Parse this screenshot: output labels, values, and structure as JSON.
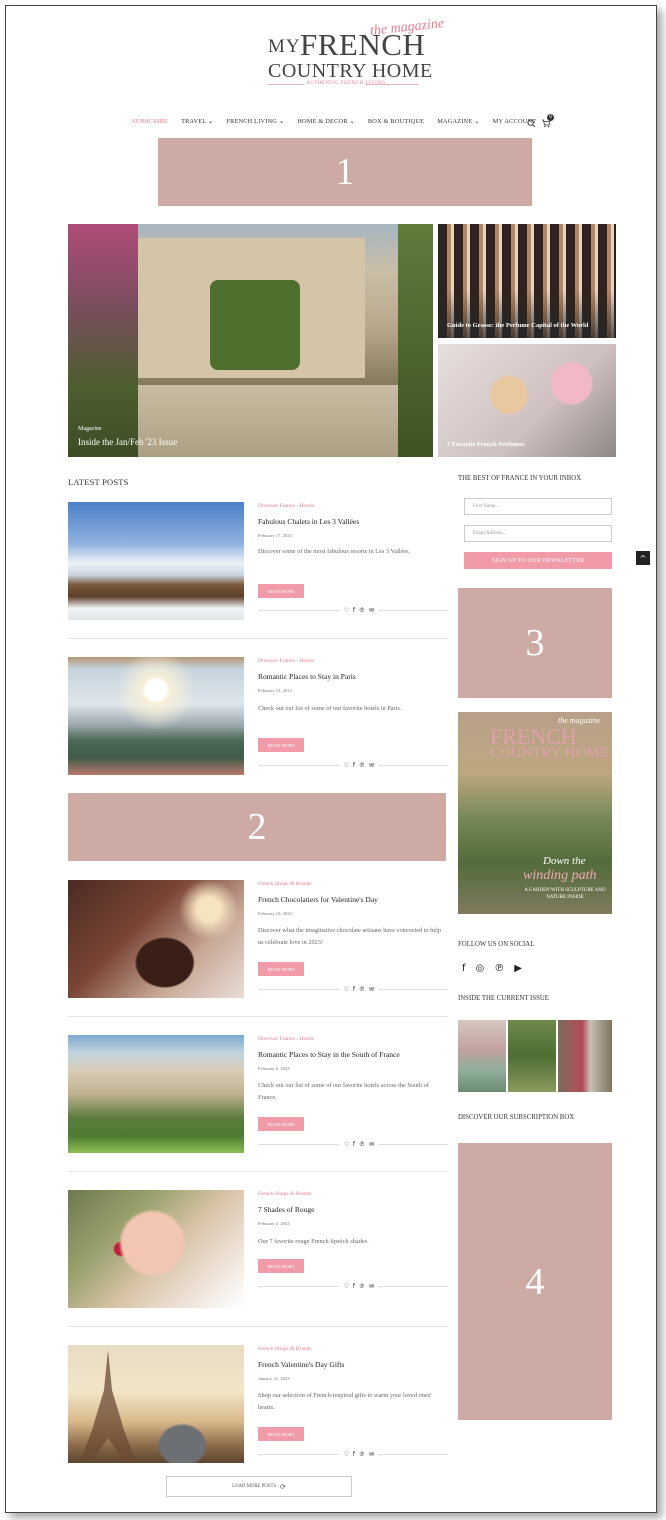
{
  "logo": {
    "my": "MY",
    "french": "FRENCH",
    "magazine": "the magazine",
    "country_home": "COUNTRY HOME",
    "tagline": "AUTHENTIC FRENCH LIVING"
  },
  "nav": {
    "items": [
      "SUBSCRIBE",
      "TRAVEL ⌄",
      "FRENCH LIVING ⌄",
      "HOME & DECOR ⌄",
      "BOX & BOUTIQUE",
      "MAGAZINE ⌄",
      "MY ACCOUNT"
    ],
    "cart_count": "0"
  },
  "ads": [
    "1",
    "2",
    "3",
    "4"
  ],
  "featured": {
    "main_category": "Magazine",
    "main_title": "Inside the Jan/Feb '23 Issue",
    "side": [
      {
        "title": "Guide to Grasse: the Perfume Capital of the World"
      },
      {
        "title": "7 Favorite French Perfumes"
      }
    ]
  },
  "latest_posts_title": "LATEST POSTS",
  "posts": [
    {
      "category": "Discover France  ›  Hotels",
      "title": "Fabulous Chalets in Les 3 Vallées",
      "date": "February 17, 2023",
      "excerpt": "Discover some of the most fabulous resorts in Les 3 Vallées.",
      "read_more": "READ MORE"
    },
    {
      "category": "Discover France  ›  Hotels",
      "title": "Romantic Places to Stay in Paris",
      "date": "February 13, 2023",
      "excerpt": "Check out our list of some of our favorite hotels in Paris.",
      "read_more": "READ MORE"
    },
    {
      "category": "French Shops & Brands",
      "title": "French Chocolatiers for Valentine's Day",
      "date": "February 10, 2023",
      "excerpt": "Discover what the imaginative chocolate artisans have concocted to help us celebrate love in 2023!",
      "read_more": "READ MORE"
    },
    {
      "category": "Discover France  ›  Hotels",
      "title": "Romantic Places to Stay in the South of France",
      "date": "February 6, 2023",
      "excerpt": "Check out our list of some of our favorite hotels across the South of France.",
      "read_more": "READ MORE"
    },
    {
      "category": "French Shops & Brands",
      "title": "7 Shades of Rouge",
      "date": "February 2, 2023",
      "excerpt": "Our 7 favorite rouge French lipstick shades.",
      "read_more": "READ MORE"
    },
    {
      "category": "French Shops & Brands",
      "title": "French Valentine's Day Gifts",
      "date": "January 31, 2023",
      "excerpt": "Shop our selection of French-inspired gifts to warm your loved ones' hearts.",
      "read_more": "READ MORE"
    }
  ],
  "share_icons": [
    "♡",
    "f",
    "℗",
    "✉"
  ],
  "load_more": "LOAD MORE POSTS",
  "sidebar": {
    "newsletter_title": "THE BEST OF FRANCE IN YOUR INBOX",
    "first_name_placeholder": "First Name...",
    "email_placeholder": "Email Address...",
    "signup_label": "SIGN UP TO OUR NEWSLETTER",
    "cover": {
      "magazine": "the magazine",
      "title": "FRENCH",
      "title2": "COUNTRY HOME",
      "headline1": "Down the",
      "headline2": "winding path",
      "subline": "A GARDEN WITH SCULPTURE AND NATURE INSIDE"
    },
    "follow_title": "FOLLOW US ON SOCIAL",
    "social_icons": [
      "f",
      "◎",
      "℗",
      "▶"
    ],
    "issue_title": "INSIDE THE CURRENT ISSUE",
    "subscription_title": "DISCOVER OUR SUBSCRIPTION BOX"
  },
  "scroll_top": "^"
}
